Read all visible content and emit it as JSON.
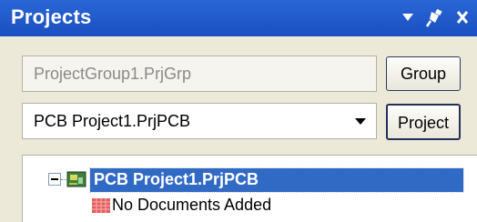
{
  "panel": {
    "title": "Projects",
    "controls": [
      "dropdown-icon",
      "pin-icon",
      "close-icon"
    ]
  },
  "project_group": {
    "value": "ProjectGroup1.PrjGrp",
    "button_label": "Group"
  },
  "project": {
    "selected": "PCB Project1.PrjPCB",
    "button_label": "Project"
  },
  "tree": {
    "root_label": "PCB Project1.PrjPCB",
    "child_label": "No Documents Added"
  },
  "colors": {
    "titlebar": "#1f58c9",
    "selection": "#316ac5",
    "panel_bg": "#ece9d8"
  }
}
